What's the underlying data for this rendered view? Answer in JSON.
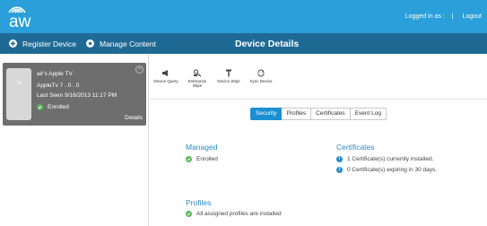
{
  "header": {
    "logo_text": "aw",
    "logged_in_label": "Logged in as :",
    "separator": "|",
    "logout_label": "Logout"
  },
  "nav": {
    "register_label": "Register Device",
    "manage_label": "Manage Content",
    "page_title": "Device Details"
  },
  "device_card": {
    "thumb_logo": " tv",
    "name": "air's Apple TV",
    "os": "AppleTv  7 . 0 . 0",
    "last_seen": "Last Seen 9/16/2013 11:17 PM",
    "status": "Enrolled",
    "details_link": "Details"
  },
  "toolbar": {
    "items": [
      {
        "label": "Device Query",
        "icon": "megaphone-icon"
      },
      {
        "label": "Enterprise Wipe",
        "icon": "enterprise-wipe-icon"
      },
      {
        "label": "Device Wipe",
        "icon": "device-wipe-icon"
      },
      {
        "label": "Sync Device",
        "icon": "sync-icon"
      }
    ]
  },
  "tabs": [
    {
      "label": "Security",
      "active": true
    },
    {
      "label": "Profiles",
      "active": false
    },
    {
      "label": "Certificates",
      "active": false
    },
    {
      "label": "Event Log",
      "active": false
    }
  ],
  "security": {
    "managed_title": "Managed",
    "managed_status": "Enrolled",
    "certificates_title": "Certificates",
    "cert_installed": "1 Certificate(s) currently installed.",
    "cert_expiring": "0 Certificate(s) expiring in 30 days.",
    "profiles_title": "Profiles",
    "profiles_status": "All assigned profiles are installed"
  },
  "colors": {
    "header_blue": "#2b9fd9",
    "nav_blue": "#1f6a95",
    "accent": "#1c8fd3",
    "success": "#5cb85c"
  }
}
